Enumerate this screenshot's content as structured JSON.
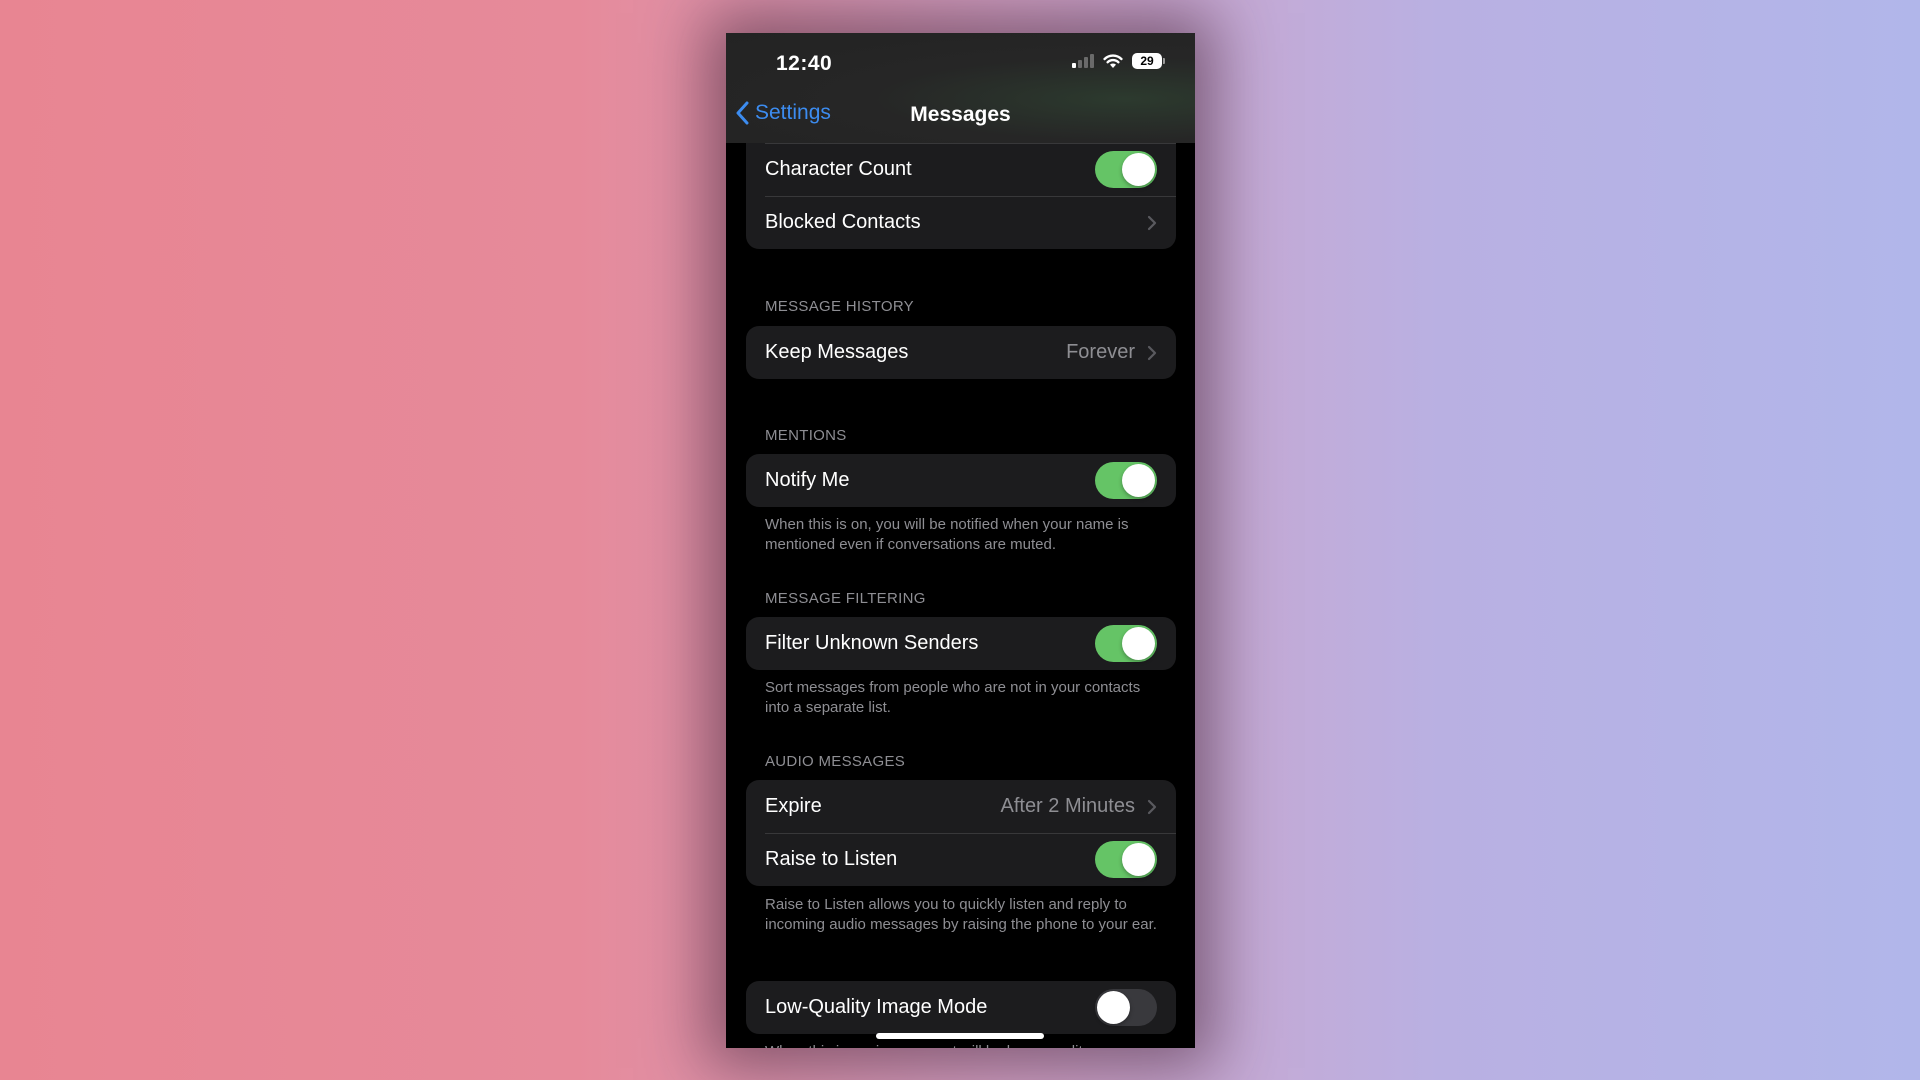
{
  "status_bar": {
    "time": "12:40",
    "signal_bars": 1,
    "signal_total": 4,
    "battery_percent": "29"
  },
  "nav": {
    "back_label": "Settings",
    "title": "Messages"
  },
  "top_group": {
    "rows": [
      {
        "label": "",
        "type": "toggle",
        "on": true
      },
      {
        "label": "Character Count",
        "type": "toggle",
        "on": true
      },
      {
        "label": "Blocked Contacts",
        "type": "disclosure"
      }
    ]
  },
  "message_history": {
    "header": "MESSAGE HISTORY",
    "rows": [
      {
        "label": "Keep Messages",
        "value": "Forever",
        "type": "disclosure"
      }
    ]
  },
  "mentions": {
    "header": "MENTIONS",
    "rows": [
      {
        "label": "Notify Me",
        "type": "toggle",
        "on": true
      }
    ],
    "footer": "When this is on, you will be notified when your name is mentioned even if conversations are muted."
  },
  "message_filtering": {
    "header": "MESSAGE FILTERING",
    "rows": [
      {
        "label": "Filter Unknown Senders",
        "type": "toggle",
        "on": true
      }
    ],
    "footer": "Sort messages from people who are not in your contacts into a separate list."
  },
  "audio_messages": {
    "header": "AUDIO MESSAGES",
    "rows": [
      {
        "label": "Expire",
        "value": "After 2 Minutes",
        "type": "disclosure"
      },
      {
        "label": "Raise to Listen",
        "type": "toggle",
        "on": true
      }
    ],
    "footer": "Raise to Listen allows you to quickly listen and reply to incoming audio messages by raising the phone to your ear."
  },
  "low_quality": {
    "rows": [
      {
        "label": "Low-Quality Image Mode",
        "type": "toggle",
        "on": false
      }
    ],
    "footer": "When this is on, images sent will be lower quality."
  },
  "colors": {
    "accent": "#3c8cf0",
    "toggle_on": "#65c466",
    "toggle_off": "#39393d",
    "cell": "#1c1c1e",
    "secondary_text": "#8e8e93"
  }
}
